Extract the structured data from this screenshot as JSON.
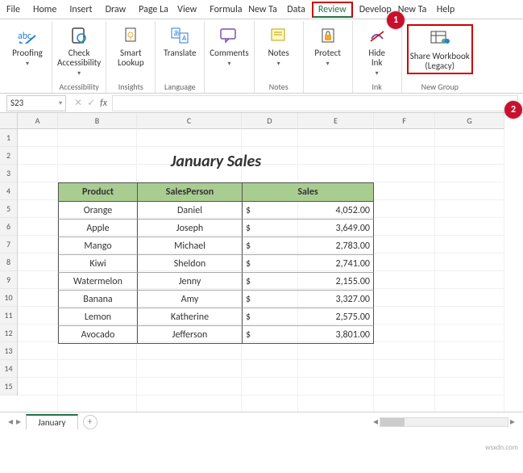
{
  "tabs": [
    "File",
    "Home",
    "Insert",
    "Draw",
    "Page La",
    "View",
    "Formula",
    "New Ta",
    "Data",
    "Review",
    "Develop",
    "New Ta",
    "Help"
  ],
  "active_tab": "Review",
  "ribbon": {
    "proofing": {
      "spelling": "Proofing",
      "group": ""
    },
    "accessibility": {
      "btn": "Check\nAccessibility",
      "group": "Accessibility"
    },
    "insights": {
      "btn": "Smart\nLookup",
      "group": "Insights"
    },
    "language": {
      "btn": "Translate",
      "group": "Language"
    },
    "comments": {
      "btn": "Comments",
      "group": ""
    },
    "notes": {
      "btn": "Notes",
      "group": "Notes"
    },
    "protect": {
      "btn": "Protect",
      "group": ""
    },
    "ink": {
      "btn": "Hide\nInk",
      "group": "Ink"
    },
    "newgroup": {
      "btn": "Share Workbook\n(Legacy)",
      "group": "New Group"
    }
  },
  "namebox": "S23",
  "fx_label": "fx",
  "title": "January Sales",
  "columns": [
    "A",
    "B",
    "C",
    "D",
    "E",
    "F",
    "G"
  ],
  "rows": [
    "1",
    "2",
    "3",
    "4",
    "5",
    "6",
    "7",
    "8",
    "9",
    "10",
    "11",
    "12",
    "13",
    "14",
    "15"
  ],
  "headers": {
    "product": "Product",
    "salesperson": "SalesPerson",
    "sales": "Sales"
  },
  "data": [
    {
      "product": "Orange",
      "person": "Daniel",
      "cur": "$",
      "amt": "4,052.00"
    },
    {
      "product": "Apple",
      "person": "Joseph",
      "cur": "$",
      "amt": "3,649.00"
    },
    {
      "product": "Mango",
      "person": "Michael",
      "cur": "$",
      "amt": "2,783.00"
    },
    {
      "product": "Kiwi",
      "person": "Sheldon",
      "cur": "$",
      "amt": "2,741.00"
    },
    {
      "product": "Watermelon",
      "person": "Jenny",
      "cur": "$",
      "amt": "2,155.00"
    },
    {
      "product": "Banana",
      "person": "Amy",
      "cur": "$",
      "amt": "3,327.00"
    },
    {
      "product": "Lemon",
      "person": "Katherine",
      "cur": "$",
      "amt": "2,575.00"
    },
    {
      "product": "Avocado",
      "person": "Jefferson",
      "cur": "$",
      "amt": "3,801.00"
    }
  ],
  "sheet": "January",
  "callouts": {
    "one": "1",
    "two": "2"
  },
  "watermark": "wsxdn.com"
}
